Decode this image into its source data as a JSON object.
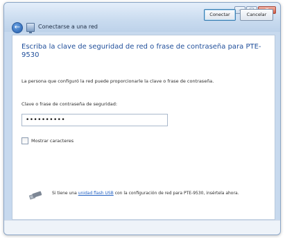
{
  "window": {
    "title": "Conectarse a una red",
    "controls": {
      "minimize": "–",
      "maximize": "□",
      "close": "✕"
    }
  },
  "icons": {
    "back": "back-arrow-icon",
    "network": "network-icon",
    "usb": "usb-drive-icon"
  },
  "heading": "Escriba la clave de seguridad de red o frase de contraseña para PTE-9530",
  "description": "La persona que configuró la red puede proporcionarle la clave o frase de contraseña.",
  "security_key": {
    "label": "Clave o frase de contraseña de seguridad:",
    "value": "••••••••••"
  },
  "show_characters": {
    "label": "Mostrar caracteres",
    "checked": false
  },
  "usb_hint": {
    "before": "Si tiene una ",
    "link": "unidad flash USB",
    "after": " con la configuración de red para PTE-9530, insértela ahora."
  },
  "buttons": {
    "connect": "Conectar",
    "cancel": "Cancelar"
  },
  "colors": {
    "heading": "#1f4e9a",
    "link": "#1f5fc2",
    "frame": "#c7d9ee"
  }
}
